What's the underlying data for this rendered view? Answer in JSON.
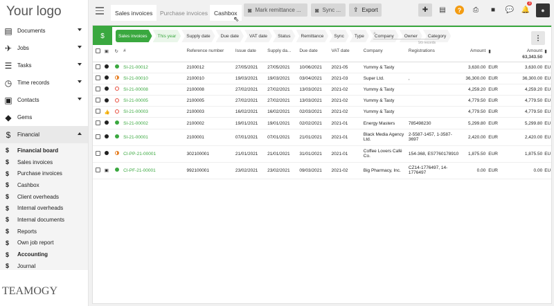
{
  "logo_text": "Your logo",
  "footer_logo": "TEAMOGY",
  "sidebar": {
    "items": [
      {
        "label": "Documents",
        "icon": "document-icon",
        "caret": true
      },
      {
        "label": "Jobs",
        "icon": "rocket-icon",
        "caret": true
      },
      {
        "label": "Tasks",
        "icon": "tasks-icon",
        "caret": true
      },
      {
        "label": "Time records",
        "icon": "clock-icon",
        "caret": true
      },
      {
        "label": "Contacts",
        "icon": "contacts-icon",
        "caret": true
      },
      {
        "label": "Gems",
        "icon": "gem-icon",
        "caret": false
      },
      {
        "label": "Financial",
        "icon": "dollar-icon",
        "caret": true
      }
    ],
    "submenu": [
      {
        "label": "Financial board",
        "bold": true
      },
      {
        "label": "Sales invoices",
        "bold": false
      },
      {
        "label": "Purchase invoices",
        "bold": false
      },
      {
        "label": "Cashbox",
        "bold": false
      },
      {
        "label": "Client overheads",
        "bold": false
      },
      {
        "label": "Internal overheads",
        "bold": false
      },
      {
        "label": "Internal documents",
        "bold": false
      },
      {
        "label": "Reports",
        "bold": false
      },
      {
        "label": "Own job report",
        "bold": false
      },
      {
        "label": "Accounting",
        "bold": true
      },
      {
        "label": "Journal",
        "bold": false
      }
    ]
  },
  "topbar": {
    "tabs": [
      "Sales invoices",
      "Purchase invoices",
      "Cashbox"
    ],
    "buttons": {
      "mark_remittance": "Mark remittance ...",
      "sync": "Sync ...",
      "export": "Export"
    },
    "notification_count": "3",
    "help": "?"
  },
  "filters": {
    "crumbs": [
      "Sales invoices",
      "This year",
      "Supply date",
      "Due date",
      "VAT date",
      "Status",
      "Remittance",
      "Sync",
      "Type",
      "Company",
      "Owner",
      "Category"
    ],
    "records": "9/9 records"
  },
  "table": {
    "headers": {
      "num": "#",
      "ref": "Reference number",
      "issue": "Issue date",
      "supply": "Supply da...",
      "due": "Due date",
      "vat": "VAT date",
      "company": "Company",
      "reg": "Registrations",
      "amount": "Amount",
      "amount2": "Amount"
    },
    "total": "63,343.50",
    "rows": [
      {
        "num": "SI-21-00012",
        "ref": "2100012",
        "issue": "27/05/2021",
        "supply": "27/05/2021",
        "due": "10/06/2021",
        "vat": "2021-05",
        "company": "Yummy & Tasty",
        "reg": "",
        "amount": "3,630.00",
        "cur": "EUR",
        "amount2": "3,630.00",
        "cur2": "EU",
        "type": "dot",
        "status": "ok"
      },
      {
        "num": "SI-21-00010",
        "ref": "2100010",
        "issue": "19/03/2021",
        "supply": "19/03/2021",
        "due": "03/04/2021",
        "vat": "2021-03",
        "company": "Super Ltd.",
        "reg": ",",
        "amount": "36,300.00",
        "cur": "EUR",
        "amount2": "36,300.00",
        "cur2": "EU",
        "type": "dot",
        "status": "half"
      },
      {
        "num": "SI-21-00008",
        "ref": "2100008",
        "issue": "27/02/2021",
        "supply": "27/02/2021",
        "due": "13/03/2021",
        "vat": "2021-02",
        "company": "Yummy & Tasty",
        "reg": "",
        "amount": "4,259.20",
        "cur": "EUR",
        "amount2": "4,259.20",
        "cur2": "EU",
        "type": "dot",
        "status": "ring"
      },
      {
        "num": "SI-21-00005",
        "ref": "2100005",
        "issue": "27/02/2021",
        "supply": "27/02/2021",
        "due": "13/03/2021",
        "vat": "2021-02",
        "company": "Yummy & Tasty",
        "reg": "",
        "amount": "4,779.50",
        "cur": "EUR",
        "amount2": "4,779.50",
        "cur2": "EU",
        "type": "dot",
        "status": "ring"
      },
      {
        "num": "SI-21-00003",
        "ref": "2100003",
        "issue": "16/02/2021",
        "supply": "16/02/2021",
        "due": "02/03/2021",
        "vat": "2021-02",
        "company": "Yummy & Tasty",
        "reg": "",
        "amount": "4,779.50",
        "cur": "EUR",
        "amount2": "4,779.50",
        "cur2": "EU",
        "type": "thumb",
        "status": "ring"
      },
      {
        "num": "SI-21-00002",
        "ref": "2100002",
        "issue": "19/01/2021",
        "supply": "19/01/2021",
        "due": "02/02/2021",
        "vat": "2021-01",
        "company": "Energy Masters",
        "reg": "785498230",
        "amount": "5,299.80",
        "cur": "EUR",
        "amount2": "5,299.80",
        "cur2": "EU",
        "type": "dot",
        "status": "ok"
      },
      {
        "num": "SI-21-00001",
        "ref": "2100001",
        "issue": "07/01/2021",
        "supply": "07/01/2021",
        "due": "21/01/2021",
        "vat": "2021-01",
        "company": "Black Media Agency Ltd.",
        "reg": "2-5587-1457, 1-3587-3697",
        "amount": "2,420.00",
        "cur": "EUR",
        "amount2": "2,420.00",
        "cur2": "EU",
        "type": "dot",
        "status": "ok"
      },
      {
        "num": "CI-PP-21-00001",
        "ref": "302100001",
        "issue": "21/01/2021",
        "supply": "21/01/2021",
        "due": "31/01/2021",
        "vat": "2021-01",
        "company": "Coffee Lovers Café Co.",
        "reg": "154-368, ES7760178910",
        "amount": "1,875.50",
        "cur": "EUR",
        "amount2": "1,875.50",
        "cur2": "EU",
        "type": "dot",
        "status": "half"
      },
      {
        "num": "CI-PF-21-00001",
        "ref": "992100001",
        "issue": "23/02/2021",
        "supply": "23/02/2021",
        "due": "09/03/2021",
        "vat": "2021-02",
        "company": "Big Pharmacy, Inc.",
        "reg": "CZ14-1776497, 14-1776497",
        "amount": "0.00",
        "cur": "EUR",
        "amount2": "0.00",
        "cur2": "EU",
        "type": "inbox",
        "status": "ok"
      }
    ]
  }
}
